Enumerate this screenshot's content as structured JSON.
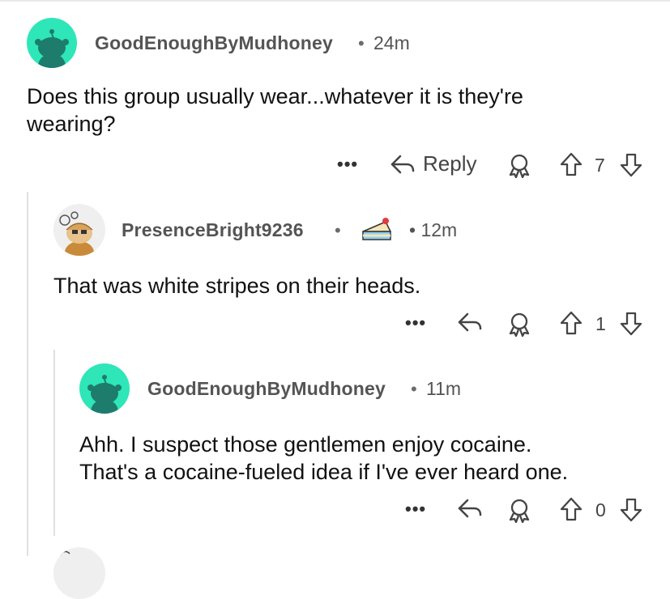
{
  "comments": [
    {
      "username": "GoodEnoughByMudhoney",
      "separator": "•",
      "time": "24m",
      "lines": [
        "Does this group usually wear...whatever it is they're",
        "wearing?"
      ],
      "more": "•••",
      "reply_label": "Reply",
      "votes": "7"
    },
    {
      "username": "PresenceBright9236",
      "separator": "•",
      "time": "• 12m",
      "lines": [
        "That was white stripes on their heads."
      ],
      "more": "•••",
      "votes": "1"
    },
    {
      "username": "GoodEnoughByMudhoney",
      "separator": "•",
      "time": "11m",
      "lines": [
        "Ahh. I suspect those gentlemen enjoy cocaine.",
        "That's a cocaine-fueled idea if I've ever heard one."
      ],
      "more": "•••",
      "votes": "0"
    }
  ],
  "colors": {
    "avatar_green": "#2ee6b8",
    "snoo_dark": "#1d7c6b"
  },
  "icons": [
    "reply-arrow-icon",
    "award-icon",
    "upvote-icon",
    "downvote-icon",
    "cake-icon",
    "more-icon"
  ]
}
